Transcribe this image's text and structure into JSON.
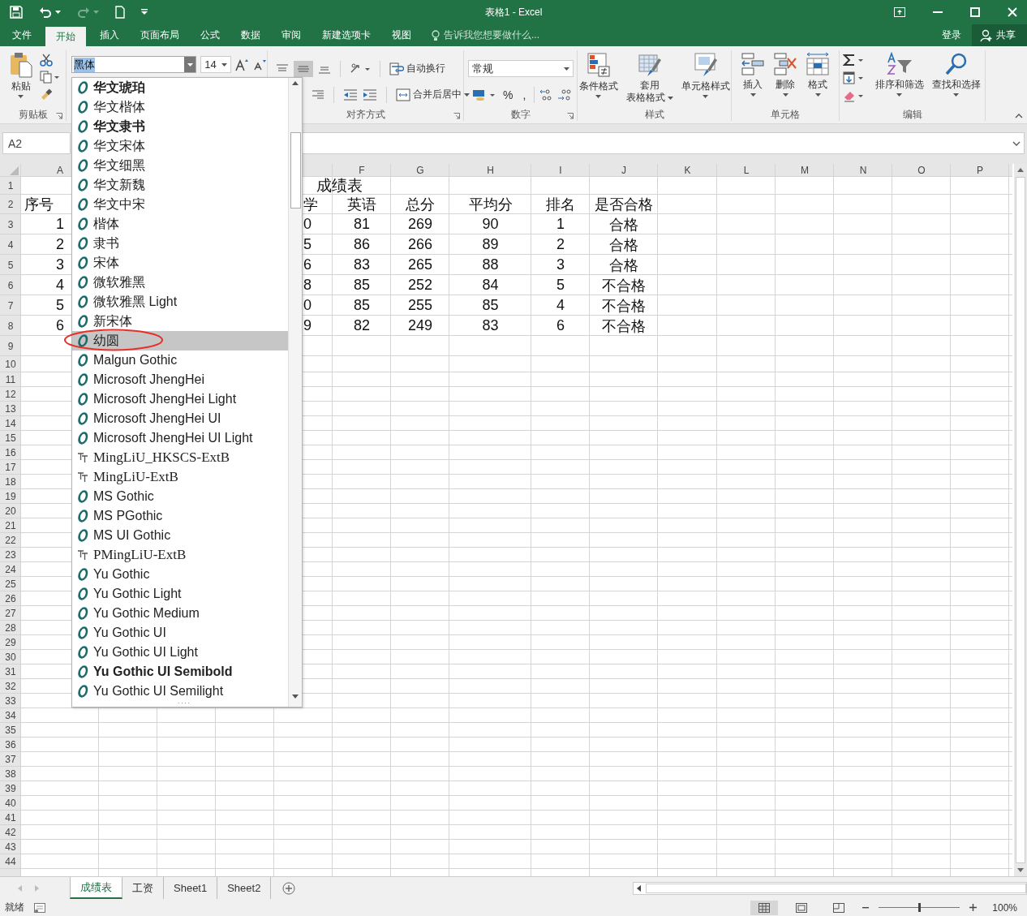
{
  "window": {
    "title": "表格1 - Excel"
  },
  "quick_access": {
    "redo": {
      "disabled": true
    }
  },
  "ribbon_tabs": [
    {
      "label": "文件",
      "selected": false
    },
    {
      "label": "开始",
      "selected": true
    },
    {
      "label": "插入",
      "selected": false
    },
    {
      "label": "页面布局",
      "selected": false
    },
    {
      "label": "公式",
      "selected": false
    },
    {
      "label": "数据",
      "selected": false
    },
    {
      "label": "审阅",
      "selected": false
    },
    {
      "label": "新建选项卡",
      "selected": false
    },
    {
      "label": "视图",
      "selected": false
    }
  ],
  "tell_me": {
    "placeholder": "告诉我您想要做什么..."
  },
  "account": {
    "sign_in": "登录",
    "share": "共享"
  },
  "ribbon": {
    "clipboard": {
      "paste": "粘贴",
      "group": "剪贴板"
    },
    "font": {
      "name": "黑体",
      "size": "14"
    },
    "alignment": {
      "middle_selected": true,
      "wrap": "自动换行",
      "merge": "合并后居中",
      "group": "对齐方式"
    },
    "number": {
      "format": "常规",
      "percent": "%",
      "comma": ",",
      "group": "数字"
    },
    "styles": {
      "conditional": "条件格式",
      "table": [
        "套用",
        "表格格式"
      ],
      "cell_styles": "单元格样式",
      "group": "样式"
    },
    "cells": {
      "insert": "插入",
      "delete": "删除",
      "format": "格式",
      "group": "单元格"
    },
    "editing": {
      "sort": "排序和筛选",
      "find": "查找和选择",
      "group": "编辑"
    }
  },
  "name_box": "A2",
  "font_menu": {
    "items": [
      {
        "label": "华文琥珀",
        "kind": "opentype",
        "bold": true,
        "selected": false
      },
      {
        "label": "华文楷体",
        "kind": "opentype",
        "bold": false,
        "selected": false
      },
      {
        "label": "华文隶书",
        "kind": "opentype",
        "bold": true,
        "selected": false
      },
      {
        "label": "华文宋体",
        "kind": "opentype",
        "bold": false,
        "selected": false
      },
      {
        "label": "华文细黑",
        "kind": "opentype",
        "bold": false,
        "selected": false
      },
      {
        "label": "华文新魏",
        "kind": "opentype",
        "bold": false,
        "selected": false
      },
      {
        "label": "华文中宋",
        "kind": "opentype",
        "bold": false,
        "selected": false
      },
      {
        "label": "楷体",
        "kind": "opentype",
        "bold": false,
        "selected": false
      },
      {
        "label": "隶书",
        "kind": "opentype",
        "bold": false,
        "selected": false
      },
      {
        "label": "宋体",
        "kind": "opentype",
        "bold": false,
        "selected": false
      },
      {
        "label": "微软雅黑",
        "kind": "opentype",
        "bold": false,
        "selected": false
      },
      {
        "label": "微软雅黑 Light",
        "kind": "opentype",
        "bold": false,
        "selected": false
      },
      {
        "label": "新宋体",
        "kind": "opentype",
        "bold": false,
        "selected": false
      },
      {
        "label": "幼圆",
        "kind": "opentype",
        "bold": false,
        "selected": true
      },
      {
        "label": "Malgun Gothic",
        "kind": "opentype",
        "bold": false,
        "selected": false
      },
      {
        "label": "Microsoft JhengHei",
        "kind": "opentype",
        "bold": false,
        "selected": false
      },
      {
        "label": "Microsoft JhengHei Light",
        "kind": "opentype",
        "bold": false,
        "selected": false
      },
      {
        "label": "Microsoft JhengHei UI",
        "kind": "opentype",
        "bold": false,
        "selected": false
      },
      {
        "label": "Microsoft JhengHei UI Light",
        "kind": "opentype",
        "bold": false,
        "selected": false
      },
      {
        "label": "MingLiU_HKSCS-ExtB",
        "kind": "truetype",
        "bold": false,
        "selected": false
      },
      {
        "label": "MingLiU-ExtB",
        "kind": "truetype",
        "bold": false,
        "selected": false
      },
      {
        "label": "MS Gothic",
        "kind": "opentype",
        "bold": false,
        "selected": false
      },
      {
        "label": "MS PGothic",
        "kind": "opentype",
        "bold": false,
        "selected": false
      },
      {
        "label": "MS UI Gothic",
        "kind": "opentype",
        "bold": false,
        "selected": false
      },
      {
        "label": "PMingLiU-ExtB",
        "kind": "truetype",
        "bold": false,
        "selected": false
      },
      {
        "label": "Yu Gothic",
        "kind": "opentype",
        "bold": false,
        "selected": false
      },
      {
        "label": "Yu Gothic Light",
        "kind": "opentype",
        "bold": false,
        "selected": false
      },
      {
        "label": "Yu Gothic Medium",
        "kind": "opentype",
        "bold": false,
        "selected": false
      },
      {
        "label": "Yu Gothic UI",
        "kind": "opentype",
        "bold": false,
        "selected": false
      },
      {
        "label": "Yu Gothic UI Light",
        "kind": "opentype",
        "bold": false,
        "selected": false
      },
      {
        "label": "Yu Gothic UI Semibold",
        "kind": "opentype",
        "bold": true,
        "selected": false
      },
      {
        "label": "Yu Gothic UI Semilight",
        "kind": "opentype",
        "bold": false,
        "selected": false
      }
    ]
  },
  "sheet": {
    "columns": [
      "A",
      "F",
      "G",
      "H",
      "I",
      "J",
      "K",
      "L",
      "M",
      "N",
      "O",
      "P"
    ],
    "rows": [
      {
        "header": "1",
        "title": "成绩表"
      },
      {
        "header": "2",
        "cells": {
          "A": "序号",
          "E": "学",
          "F": "英语",
          "G": "总分",
          "H": "平均分",
          "I": "排名",
          "J": "是否合格"
        }
      },
      {
        "header": "3",
        "cells": {
          "A": "1",
          "E": "0",
          "F": "81",
          "G": "269",
          "H": "90",
          "I": "1",
          "J": "合格"
        }
      },
      {
        "header": "4",
        "cells": {
          "A": "2",
          "E": "5",
          "F": "86",
          "G": "266",
          "H": "89",
          "I": "2",
          "J": "合格"
        }
      },
      {
        "header": "5",
        "cells": {
          "A": "3",
          "E": "6",
          "F": "83",
          "G": "265",
          "H": "88",
          "I": "3",
          "J": "合格"
        }
      },
      {
        "header": "6",
        "cells": {
          "A": "4",
          "E": "8",
          "F": "85",
          "G": "252",
          "H": "84",
          "I": "5",
          "J": "不合格"
        }
      },
      {
        "header": "7",
        "cells": {
          "A": "5",
          "E": "0",
          "F": "85",
          "G": "255",
          "H": "85",
          "I": "4",
          "J": "不合格"
        }
      },
      {
        "header": "8",
        "cells": {
          "A": "6",
          "E": "9",
          "F": "82",
          "G": "249",
          "H": "83",
          "I": "6",
          "J": "不合格"
        }
      },
      {
        "header": "9"
      },
      {
        "header": "10"
      },
      {
        "header": "11"
      },
      {
        "header": "12"
      },
      {
        "header": "13"
      },
      {
        "header": "14"
      },
      {
        "header": "15"
      },
      {
        "header": "16"
      },
      {
        "header": "17"
      },
      {
        "header": "18"
      },
      {
        "header": "19"
      },
      {
        "header": "20"
      },
      {
        "header": "21"
      },
      {
        "header": "22"
      },
      {
        "header": "23"
      },
      {
        "header": "24"
      },
      {
        "header": "25"
      },
      {
        "header": "26"
      },
      {
        "header": "27"
      },
      {
        "header": "28"
      },
      {
        "header": "29"
      },
      {
        "header": "30"
      },
      {
        "header": "31"
      },
      {
        "header": "32"
      },
      {
        "header": "33"
      },
      {
        "header": "34"
      },
      {
        "header": "35"
      },
      {
        "header": "36"
      },
      {
        "header": "37"
      },
      {
        "header": "38"
      },
      {
        "header": "39"
      },
      {
        "header": "40"
      },
      {
        "header": "41"
      },
      {
        "header": "42"
      },
      {
        "header": "43"
      },
      {
        "header": "44"
      }
    ]
  },
  "sheet_tabs": [
    {
      "label": "成绩表",
      "selected": true
    },
    {
      "label": "工资",
      "selected": false
    },
    {
      "label": "Sheet1",
      "selected": false
    },
    {
      "label": "Sheet2",
      "selected": false
    }
  ],
  "status_bar": {
    "status": "就绪",
    "views": [
      {
        "kind": "normal",
        "selected": true
      },
      {
        "kind": "layout",
        "selected": false
      },
      {
        "kind": "break",
        "selected": false
      }
    ],
    "zoom": {
      "level": 0.5,
      "reading": "100%"
    }
  }
}
